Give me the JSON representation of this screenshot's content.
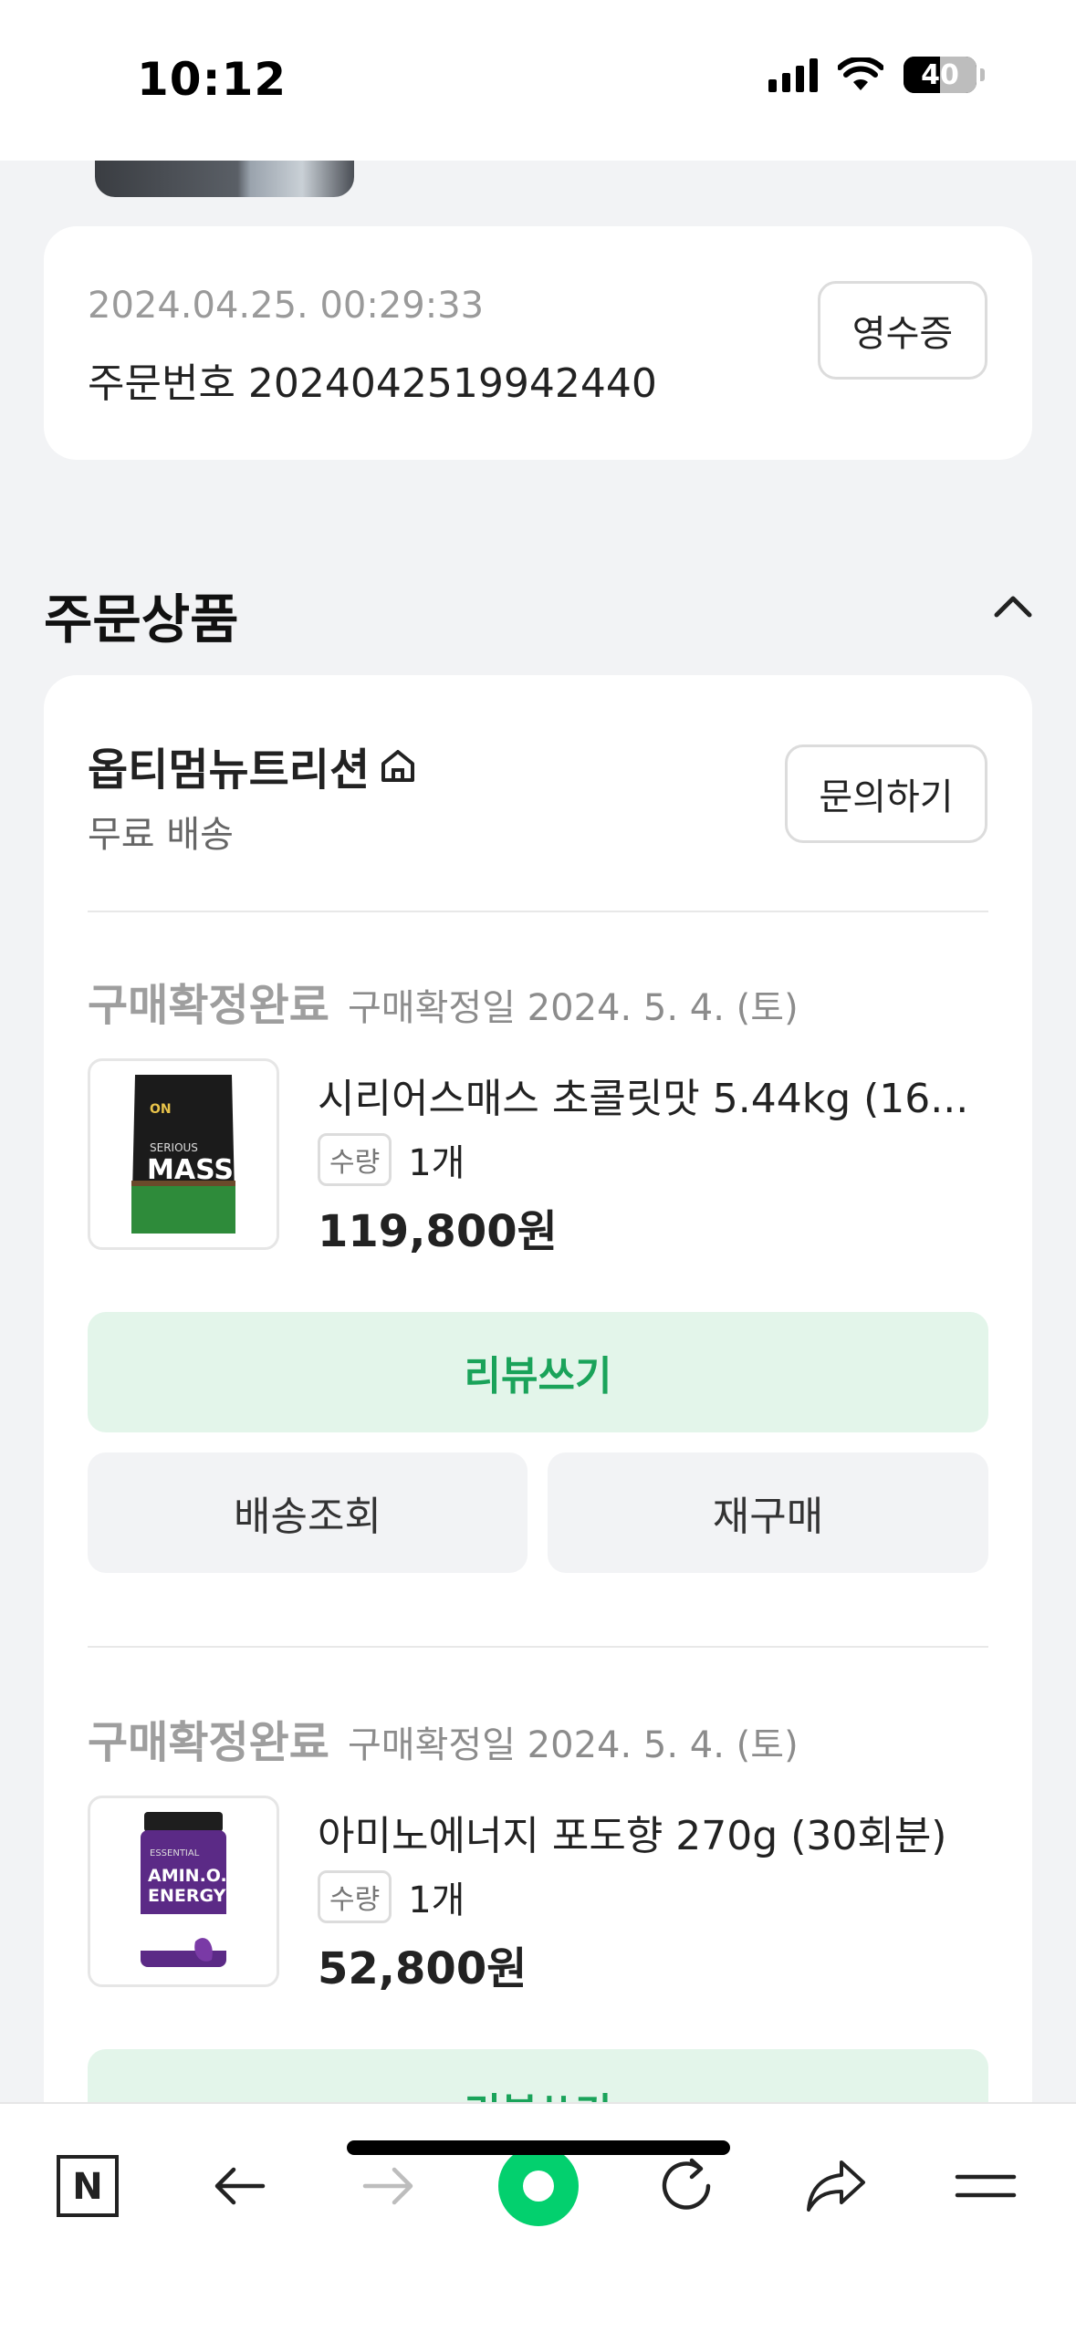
{
  "status_bar": {
    "time": "10:12",
    "battery": "40"
  },
  "order": {
    "datetime": "2024.04.25. 00:29:33",
    "number_label": "주문번호 2024042519942440",
    "receipt_button": "영수증"
  },
  "section": {
    "title": "주문상품"
  },
  "seller": {
    "name": "옵티멈뉴트리션",
    "shipping": "무료 배송",
    "inquiry_button": "문의하기"
  },
  "items": [
    {
      "status": "구매확정완료",
      "confirm_date": "구매확정일 2024. 5. 4. (토)",
      "name": "시리어스매스 초콜릿맛 5.44kg (16...",
      "qty_label": "수량",
      "qty": "1개",
      "price": "119,800원",
      "thumb_brand": "SERIOUS",
      "thumb_title": "MASS",
      "review_button": "리뷰쓰기",
      "track_button": "배송조회",
      "rebuy_button": "재구매"
    },
    {
      "status": "구매확정완료",
      "confirm_date": "구매확정일 2024. 5. 4. (토)",
      "name": "아미노에너지 포도향 270g (30회분)",
      "qty_label": "수량",
      "qty": "1개",
      "price": "52,800원",
      "thumb_brand": "ESSENTIAL",
      "thumb_title": "AMIN.O. ENERGY",
      "review_button": "리뷰쓰기"
    }
  ],
  "bottom_nav": {
    "n_logo": "N"
  },
  "colors": {
    "accent_green": "#1aa35a",
    "review_bg": "#e3f5ea",
    "nav_green": "#03d06e"
  }
}
